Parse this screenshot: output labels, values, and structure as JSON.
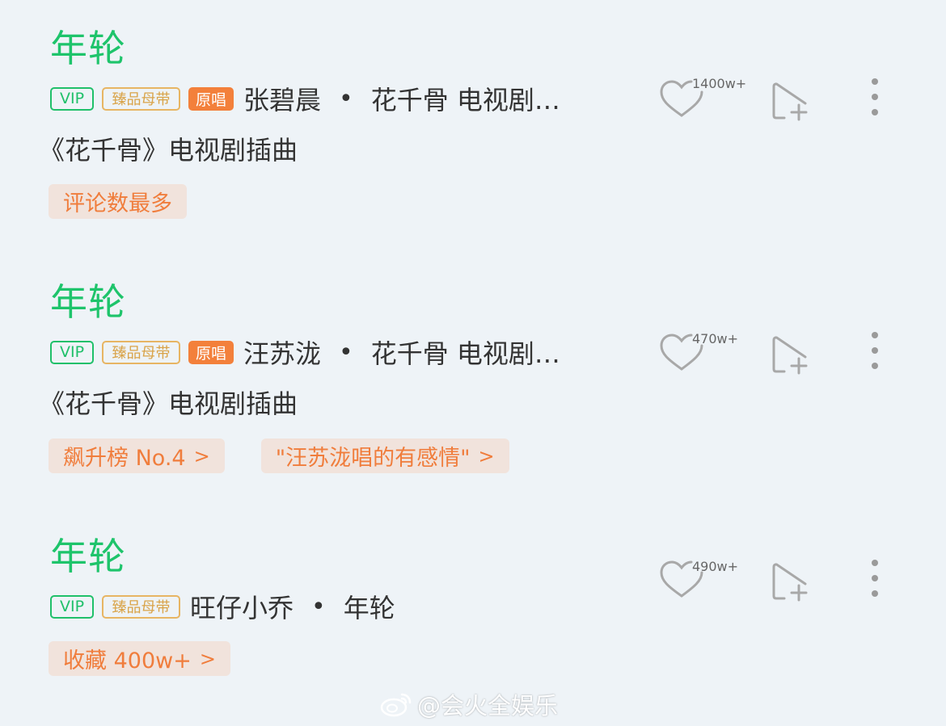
{
  "songs": [
    {
      "title": "年轮",
      "badges": {
        "vip": "VIP",
        "quality": "臻品母带",
        "original": "原唱"
      },
      "artist": "张碧晨",
      "separator": "•",
      "album": "花千骨 电视剧…",
      "description": "《花千骨》电视剧插曲",
      "tags": [
        "评论数最多"
      ],
      "like_count": "1400w+"
    },
    {
      "title": "年轮",
      "badges": {
        "vip": "VIP",
        "quality": "臻品母带",
        "original": "原唱"
      },
      "artist": "汪苏泷",
      "separator": "•",
      "album": "花千骨 电视剧…",
      "description": "《花千骨》电视剧插曲",
      "tags": [
        "飙升榜 No.4",
        "\"汪苏泷唱的有感情\""
      ],
      "like_count": "470w+"
    },
    {
      "title": "年轮",
      "badges": {
        "vip": "VIP",
        "quality": "臻品母带"
      },
      "artist": "旺仔小乔",
      "separator": "•",
      "album": "年轮",
      "tags": [
        "收藏 400w+"
      ],
      "like_count": "490w+"
    }
  ],
  "watermark": "@会火全娱乐",
  "colors": {
    "title_green": "#1ec46b",
    "tag_orange": "#f07d3c",
    "tag_bg": "#f1e3dc",
    "original_badge": "#f3803b"
  }
}
